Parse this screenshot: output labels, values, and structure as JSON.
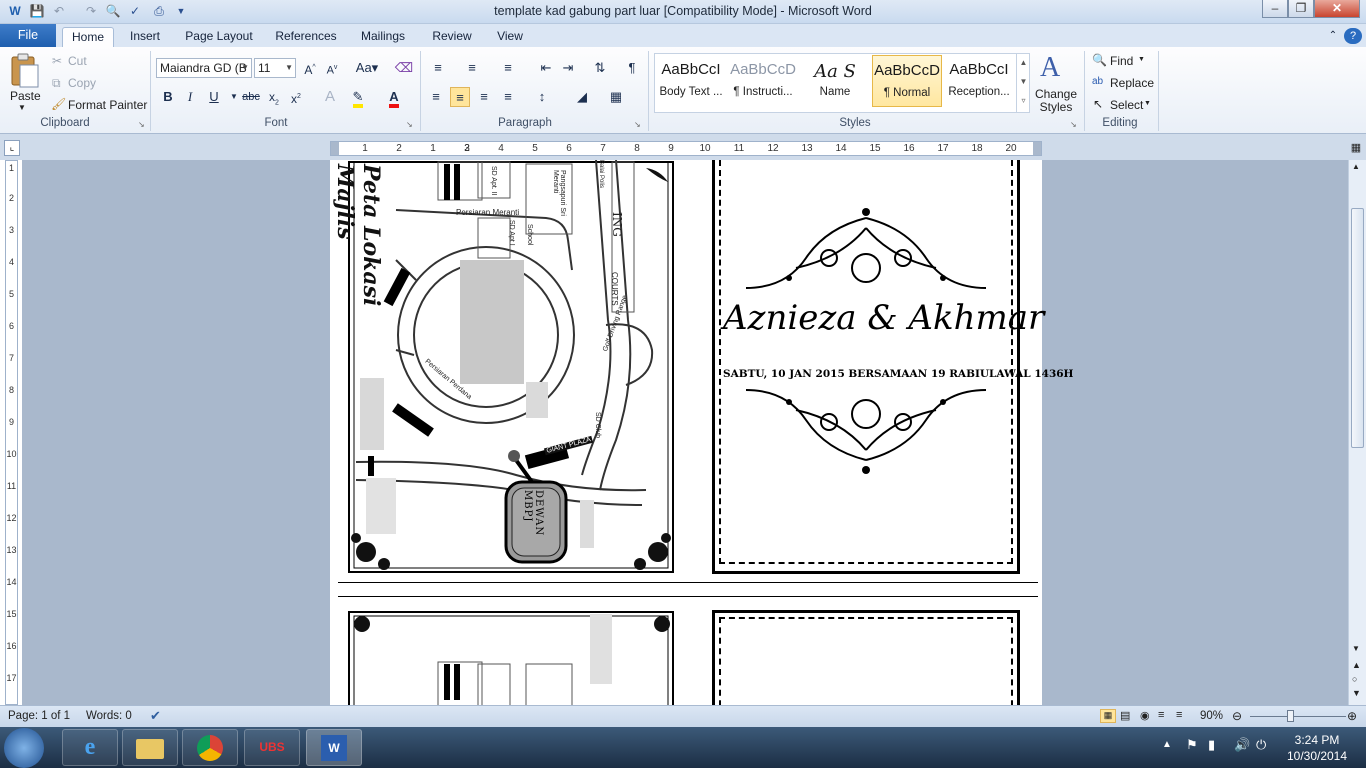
{
  "window": {
    "title": "template kad gabung part luar [Compatibility Mode]  -  Microsoft Word"
  },
  "tabs": [
    "File",
    "Home",
    "Insert",
    "Page Layout",
    "References",
    "Mailings",
    "Review",
    "View"
  ],
  "active_tab": "Home",
  "ribbon": {
    "clipboard": {
      "paste": "Paste",
      "cut": "Cut",
      "copy": "Copy",
      "format_painter": "Format Painter",
      "label": "Clipboard"
    },
    "font": {
      "name": "Maiandra GD (B",
      "size": "11",
      "label": "Font"
    },
    "paragraph": {
      "label": "Paragraph"
    },
    "styles": {
      "label": "Styles",
      "items": [
        {
          "preview": "AaBbCcI",
          "name": "Body Text ..."
        },
        {
          "preview": "AaBbCcD",
          "name": "¶ Instructi..."
        },
        {
          "preview": "Aa S",
          "name": "Name"
        },
        {
          "preview": "AaBbCcD",
          "name": "¶ Normal"
        },
        {
          "preview": "AaBbCcI",
          "name": "Reception..."
        }
      ],
      "change_styles": "Change Styles"
    },
    "editing": {
      "find": "Find",
      "replace": "Replace",
      "select": "Select",
      "label": "Editing"
    }
  },
  "ruler_numbers": [
    "1",
    "2",
    "1",
    "2",
    "3",
    "4",
    "5",
    "6",
    "7",
    "8",
    "9",
    "10",
    "11",
    "12",
    "13",
    "14",
    "15",
    "16",
    "17",
    "18",
    "19",
    "20"
  ],
  "vruler_numbers": [
    "1",
    "2",
    "3",
    "4",
    "5",
    "6",
    "7",
    "8",
    "9",
    "10",
    "11",
    "12",
    "13",
    "14",
    "15",
    "16",
    "17",
    "18"
  ],
  "document": {
    "names": "Aznieza & Akhmar",
    "date_line": "SABTU, 10 JAN 2015 BERSAMAAN 19 RABIULAWAL 1436H",
    "map": {
      "side_text": "Peta Lokasi Majlis",
      "venue": "DEWAN MBPJ",
      "labels": [
        "Persiaran Meranti",
        "SD Apt. II",
        "Pangsapuri Sri Meranti",
        "School",
        "SD Apt I",
        "COURTS",
        "ING",
        "Persiaran Perdana",
        "Golf Driving Range",
        "SD Club",
        "GIANT PLAZA",
        "Balai Polis"
      ]
    }
  },
  "statusbar": {
    "page": "Page: 1 of 1",
    "words": "Words: 0",
    "zoom": "90%"
  },
  "taskbar": {
    "time": "3:24 PM",
    "date": "10/30/2014"
  }
}
